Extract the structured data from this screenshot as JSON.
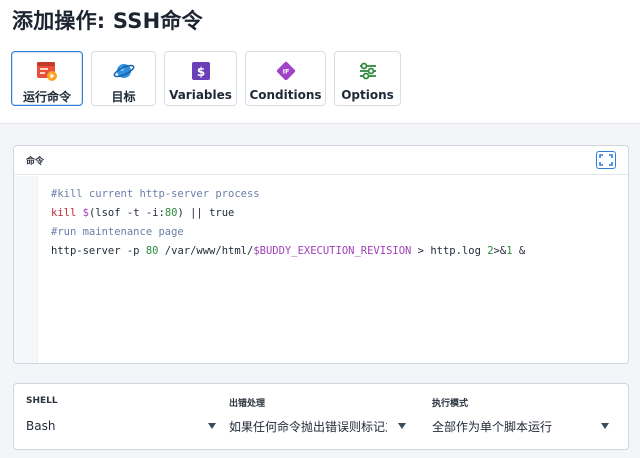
{
  "header": {
    "title_prefix": "添加操作: ",
    "title_bold": "SSH命令"
  },
  "tabs": [
    {
      "label": "运行命令",
      "icon": "run-command-icon",
      "active": true
    },
    {
      "label": "目标",
      "icon": "target-planet-icon",
      "active": false
    },
    {
      "label": "Variables",
      "icon": "variables-dollar-icon",
      "active": false
    },
    {
      "label": "Conditions",
      "icon": "conditions-if-icon",
      "active": false
    },
    {
      "label": "Options",
      "icon": "options-sliders-icon",
      "active": false
    }
  ],
  "command": {
    "label": "命令",
    "fullscreen_icon": "fullscreen-icon",
    "lines": [
      [
        {
          "t": "#kill current http-server process",
          "c": "c-com"
        }
      ],
      [
        {
          "t": "kill",
          "c": "c-kw"
        },
        {
          "t": " ",
          "c": ""
        },
        {
          "t": "$",
          "c": "c-var"
        },
        {
          "t": "(lsof -t -i:",
          "c": ""
        },
        {
          "t": "80",
          "c": "c-num"
        },
        {
          "t": ") || true",
          "c": ""
        }
      ],
      [
        {
          "t": "#run maintenance page",
          "c": "c-com"
        }
      ],
      [
        {
          "t": "http-server -p ",
          "c": ""
        },
        {
          "t": "80",
          "c": "c-num"
        },
        {
          "t": " /var/www/html/",
          "c": ""
        },
        {
          "t": "$BUDDY_EXECUTION_REVISION",
          "c": "c-var"
        },
        {
          "t": " > http.log ",
          "c": ""
        },
        {
          "t": "2",
          "c": "c-num"
        },
        {
          "t": ">&",
          "c": ""
        },
        {
          "t": "1",
          "c": "c-num"
        },
        {
          "t": " &",
          "c": ""
        }
      ]
    ]
  },
  "options": {
    "shell": {
      "label": "SHELL",
      "value": "Bash"
    },
    "error": {
      "label": "出错处理",
      "value": "如果任何命令抛出错误则标记之"
    },
    "mode": {
      "label": "执行模式",
      "value": "全部作为单个脚本运行"
    }
  },
  "colors": {
    "accent": "#2f7fd6",
    "comment": "#6b7fa8",
    "keyword": "#c0283c",
    "variable": "#a23fb8",
    "number": "#2e8b3d"
  }
}
